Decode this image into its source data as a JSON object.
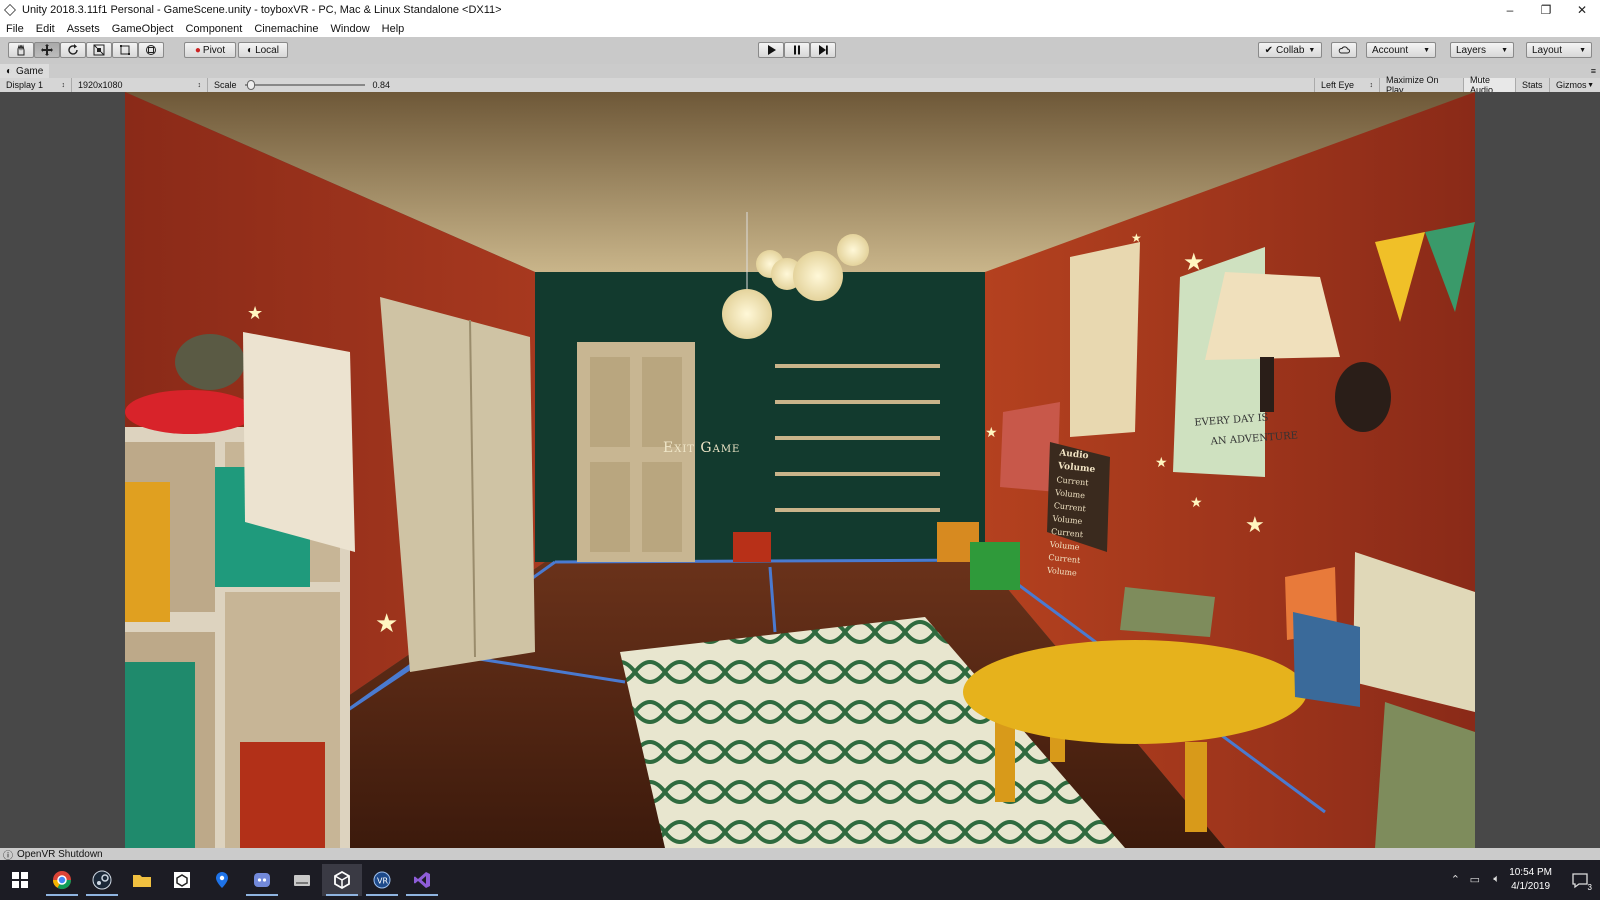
{
  "window": {
    "title": "Unity 2018.3.11f1 Personal - GameScene.unity - toyboxVR - PC, Mac & Linux Standalone <DX11>",
    "controls": {
      "minimize": "–",
      "restore": "❐",
      "close": "✕"
    }
  },
  "menu": [
    "File",
    "Edit",
    "Assets",
    "GameObject",
    "Component",
    "Cinemachine",
    "Window",
    "Help"
  ],
  "toolbar": {
    "pivot_label": "Pivot",
    "local_label": "Local",
    "collab_label": "Collab",
    "account_label": "Account",
    "layers_label": "Layers",
    "layout_label": "Layout"
  },
  "game_tab": {
    "label": "Game"
  },
  "game_bar": {
    "display": "Display 1",
    "resolution": "1920x1080",
    "scale_label": "Scale",
    "scale_value": "0.84",
    "scale_fraction": 0.02,
    "eye": "Left Eye",
    "maximize": "Maximize On Play",
    "mute": "Mute Audio",
    "stats": "Stats",
    "gizmos": "Gizmos"
  },
  "scene": {
    "exit_text": "Exit Game",
    "audio_title": "Audio Volume",
    "audio_rows": [
      "Current Volume",
      "Current Volume",
      "Current Volume",
      "Current Volume"
    ],
    "poster_text_1": "EVERY DAY IS",
    "poster_text_2": "AN ADVENTURE"
  },
  "status": {
    "message": "OpenVR Shutdown"
  },
  "taskbar": {
    "time": "10:54 PM",
    "date": "4/1/2019",
    "notifications": "3",
    "apps": [
      "windows-start",
      "chrome",
      "steam",
      "file-explorer",
      "unity-hub",
      "maps",
      "discord",
      "explorer-alt",
      "unity",
      "steamvr",
      "visual-studio"
    ]
  },
  "colors": {
    "wall_red": "#a5321f",
    "wall_green": "#123a2e",
    "floor": "#5a2a14",
    "table_yellow": "#e6b21c",
    "crate_teal": "#1f9a7c"
  }
}
